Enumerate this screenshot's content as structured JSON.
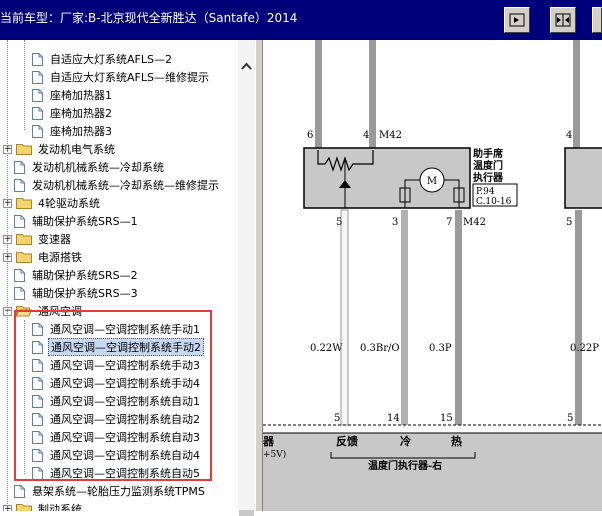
{
  "window": {
    "title": "当前车型：厂家:B-北京现代全新胜达（Santafe）2014"
  },
  "toolbar": {
    "buttons": [
      {
        "name": "expand-right-button"
      },
      {
        "name": "split-view-button"
      },
      {
        "name": "expand-left-button"
      }
    ]
  },
  "tree": {
    "items": [
      {
        "label": "自适应大灯系统AFLS—2",
        "kind": "doc",
        "indent": 2
      },
      {
        "label": "自适应大灯系统AFLS—维修提示",
        "kind": "doc",
        "indent": 2
      },
      {
        "label": "座椅加热器1",
        "kind": "doc",
        "indent": 2
      },
      {
        "label": "座椅加热器2",
        "kind": "doc",
        "indent": 2
      },
      {
        "label": "座椅加热器3",
        "kind": "doc",
        "indent": 2
      },
      {
        "label": "发动机电气系统",
        "kind": "folder",
        "indent": 1,
        "expander": "+"
      },
      {
        "label": "发动机机械系统—冷却系统",
        "kind": "doc",
        "indent": 1
      },
      {
        "label": "发动机机械系统—冷却系统—维修提示",
        "kind": "doc",
        "indent": 1
      },
      {
        "label": "4轮驱动系统",
        "kind": "folder",
        "indent": 1,
        "expander": "+"
      },
      {
        "label": "辅助保护系统SRS—1",
        "kind": "doc",
        "indent": 1
      },
      {
        "label": "变速器",
        "kind": "folder",
        "indent": 1,
        "expander": "+"
      },
      {
        "label": "电源搭铁",
        "kind": "folder",
        "indent": 1,
        "expander": "+"
      },
      {
        "label": "辅助保护系统SRS—2",
        "kind": "doc",
        "indent": 1
      },
      {
        "label": "辅助保护系统SRS—3",
        "kind": "doc",
        "indent": 1
      },
      {
        "label": "通风空调",
        "kind": "folder-open",
        "indent": 1,
        "expander": "−"
      },
      {
        "label": "通风空调—空调控制系统手动1",
        "kind": "doc",
        "indent": 2
      },
      {
        "label": "通风空调—空调控制系统手动2",
        "kind": "doc",
        "indent": 2,
        "selected": true
      },
      {
        "label": "通风空调—空调控制系统手动3",
        "kind": "doc",
        "indent": 2
      },
      {
        "label": "通风空调—空调控制系统手动4",
        "kind": "doc",
        "indent": 2
      },
      {
        "label": "通风空调—空调控制系统自动1",
        "kind": "doc",
        "indent": 2
      },
      {
        "label": "通风空调—空调控制系统自动2",
        "kind": "doc",
        "indent": 2
      },
      {
        "label": "通风空调—空调控制系统自动3",
        "kind": "doc",
        "indent": 2
      },
      {
        "label": "通风空调—空调控制系统自动4",
        "kind": "doc",
        "indent": 2
      },
      {
        "label": "通风空调—空调控制系统自动5",
        "kind": "doc",
        "indent": 2
      },
      {
        "label": "悬架系统—轮胎压力监测系统TPMS",
        "kind": "doc",
        "indent": 1
      },
      {
        "label": "制动系统",
        "kind": "folder",
        "indent": 1,
        "expander": "+"
      }
    ]
  },
  "diagram": {
    "pins_top": [
      "6",
      "4",
      "M42",
      "4"
    ],
    "component_name": [
      "助手席",
      "温度门",
      "执行器"
    ],
    "component_ref": [
      "P.94",
      "C.10-16"
    ],
    "pins_mid": [
      "5",
      "3",
      "7",
      "M42",
      "5"
    ],
    "wires": [
      "0.22W",
      "0.3Br/O",
      "0.3P",
      "0.22P"
    ],
    "pins_bottom": [
      "5",
      "14",
      "15",
      "5"
    ],
    "signals": [
      "反馈",
      "冷",
      "热"
    ],
    "left_fragment": [
      "器",
      "+5V)"
    ],
    "bottom_caption": "温度门执行器-右",
    "motor_symbol": "M",
    "colors": {
      "title_bg": "#00007b",
      "highlight": "#e53b3b",
      "component_fill": "#c8c8c8"
    }
  }
}
